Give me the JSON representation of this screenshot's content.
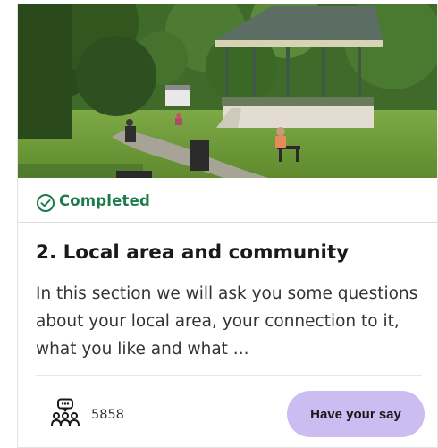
{
  "card": {
    "image": {
      "alt": "Park with bandstand, trees, benches and people on the lawn"
    },
    "status": {
      "label": "Completed",
      "icon": "check-circle-icon",
      "color": "#1e7a4c"
    },
    "title": "2. Local area and community",
    "description": "In this section we will ask you some questions about your local area, your connection to it, what you like and what ...",
    "participants": {
      "icon": "people-chat-icon",
      "count": "5858"
    },
    "cta": {
      "label": "Have your say",
      "background": "#cbbdf2"
    }
  }
}
